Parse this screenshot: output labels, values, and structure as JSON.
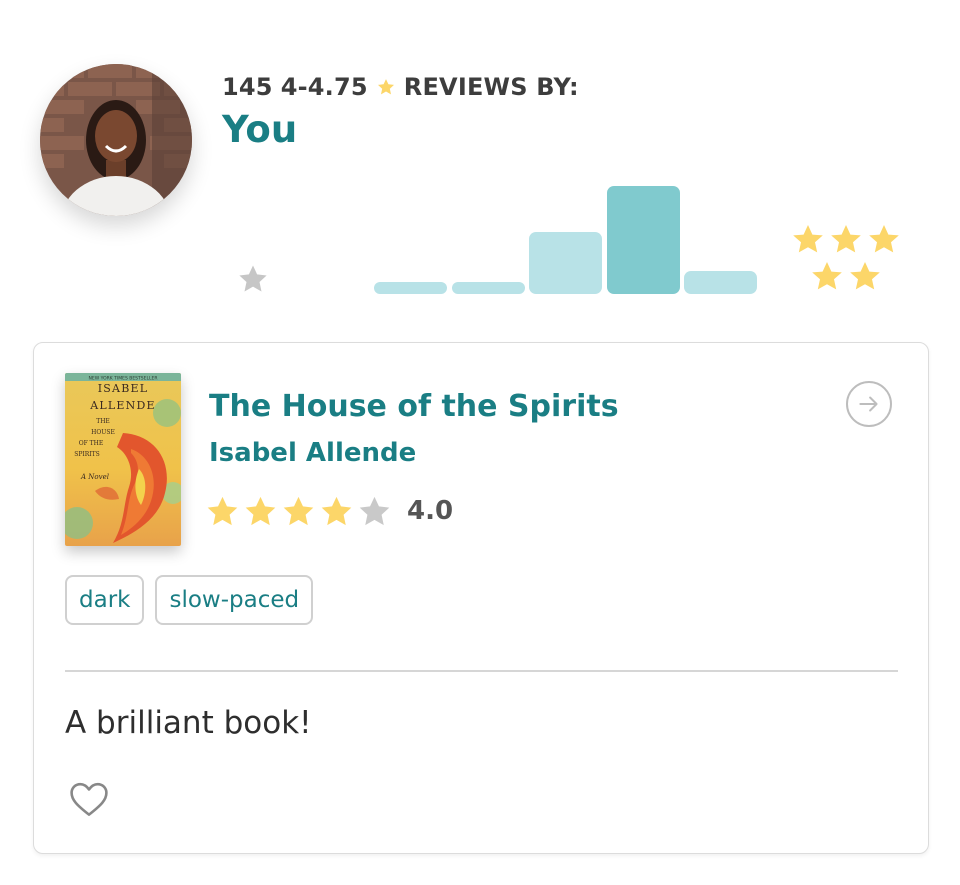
{
  "header": {
    "review_count": "145",
    "rating_range": "4-4.75",
    "reviews_by_label": "REVIEWS BY:",
    "reviewer": "You"
  },
  "histogram": {
    "low_label_icon": "star-icon",
    "high_label_icon": "five-stars-icon",
    "bars": [
      {
        "relative_height": 0.11
      },
      {
        "relative_height": 0.11
      },
      {
        "relative_height": 0.57
      },
      {
        "relative_height": 1.0
      },
      {
        "relative_height": 0.21
      }
    ],
    "colors": {
      "light": "#b8e2e7",
      "highlight": "#80cace",
      "low_star": "#c6c6c6",
      "high_star": "#fcd669"
    }
  },
  "review": {
    "title": "The House of the Spirits",
    "author": "Isabel Allende",
    "rating": "4.0",
    "filled_stars": 4,
    "total_stars": 5,
    "tags": [
      "dark",
      "slow-paced"
    ],
    "text": "A brilliant book!",
    "cover": {
      "top_banner": "NEW YORK TIMES BESTSELLER",
      "author_line_1": "ISABEL",
      "author_line_2": "ALLENDE",
      "title_lines": [
        "THE",
        "HOUSE",
        "OF THE",
        "SPIRITS"
      ],
      "subtitle": "A Novel"
    },
    "icons": {
      "open": "arrow-right-circle-icon",
      "like": "heart-icon",
      "rating_star": "star-icon"
    }
  },
  "colors": {
    "accent": "#1a7e84",
    "star_filled": "#fcd669",
    "star_empty": "#c9c9c9",
    "text_dark": "#333333"
  }
}
